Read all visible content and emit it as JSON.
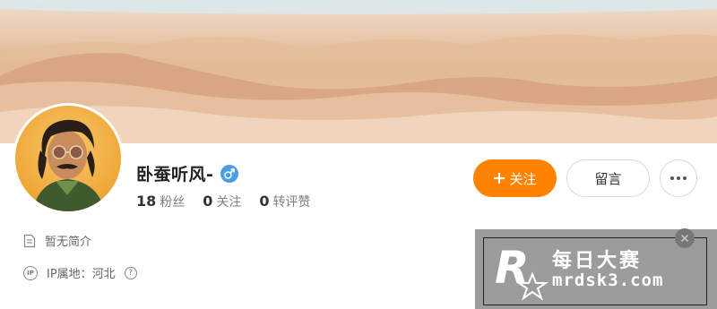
{
  "profile": {
    "username": "卧蚕听风-",
    "stats": [
      {
        "num": "18",
        "label": "粉丝"
      },
      {
        "num": "0",
        "label": "关注"
      },
      {
        "num": "0",
        "label": "转评赞"
      }
    ]
  },
  "actions": {
    "follow_label": "关注",
    "message_label": "留言"
  },
  "info": {
    "bio": "暂无简介",
    "ip_icon_text": "IP",
    "ip_location": "IP属地：河北",
    "help_text": "?"
  },
  "watermark": {
    "title": "每日大赛",
    "url": "mrdsk3.com"
  },
  "icons": {
    "gender": "male-icon",
    "bio": "document-icon",
    "ip": "ip-icon",
    "help": "question-icon",
    "follow": "plus-icon",
    "more": "ellipsis-icon"
  },
  "colors": {
    "follow_bg": "#ff8200",
    "gender_bg": "#4a9fe4",
    "avatar_bg": "#f0a93b"
  }
}
